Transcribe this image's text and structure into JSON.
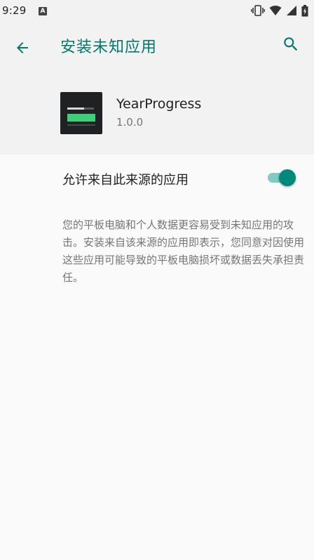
{
  "status_bar": {
    "time": "9:29",
    "notification_badge": "A",
    "icons": [
      "vibrate-icon",
      "wifi-icon",
      "signal-icon",
      "battery-icon"
    ]
  },
  "header": {
    "title": "安装未知应用",
    "back_icon": "back-arrow-icon",
    "search_icon": "search-icon"
  },
  "app": {
    "name": "YearProgress",
    "version": "1.0.0"
  },
  "toggle": {
    "label": "允许来自此来源的应用",
    "enabled": true
  },
  "description": "您的平板电脑和个人数据更容易受到未知应用的攻击。安装来自该来源的应用即表示，您同意对因使用这些应用可能导致的平板电脑损坏或数据丢失承担责任。",
  "colors": {
    "accent": "#00796b",
    "switch_thumb": "#00897b",
    "switch_track": "#80cbc4",
    "header_bg": "#f2f2f2",
    "body_bg": "#fafafa"
  }
}
